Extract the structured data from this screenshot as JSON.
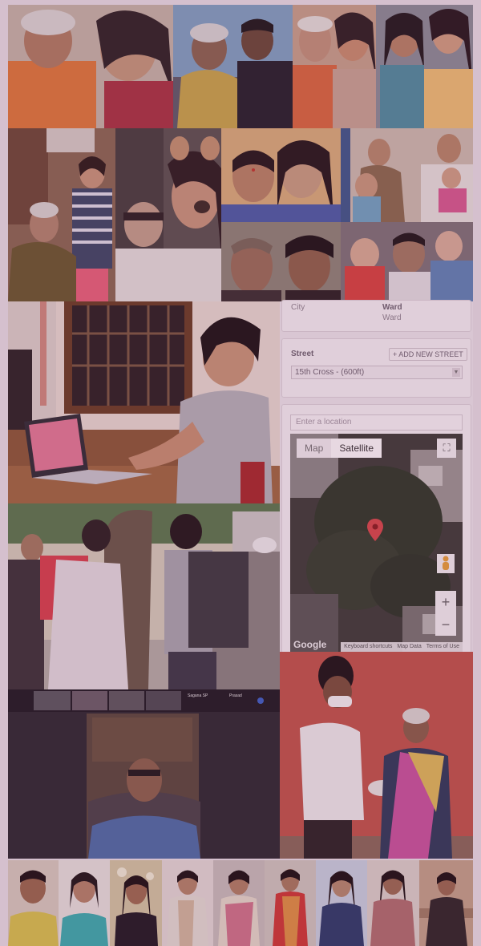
{
  "form": {
    "city_label": "City",
    "ward_label": "Ward",
    "ward_value": "Ward",
    "street_label": "Street",
    "add_street_button": "+ ADD NEW STREET",
    "street_selected": "15th Cross - (600ft)",
    "location_placeholder": "Enter a location"
  },
  "map": {
    "map_tab": "Map",
    "satellite_tab": "Satellite",
    "zoom_in": "+",
    "zoom_out": "−",
    "google": "Google",
    "footer_links": [
      "Keyboard shortcuts",
      "Map Data",
      "Terms of Use"
    ]
  },
  "video_call": {
    "participant_1": "Sagana SP",
    "participant_2": "Prasad"
  },
  "colors": {
    "tint": "#e6d5e2",
    "map_pin": "#d84a4a"
  }
}
